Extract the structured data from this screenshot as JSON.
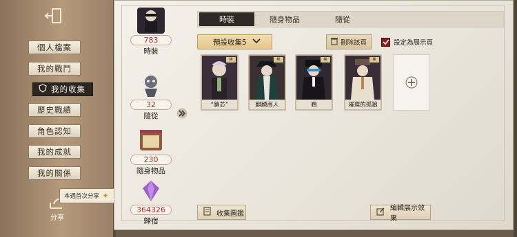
{
  "sidebar": {
    "back_icon": "exit-door-icon",
    "items": [
      {
        "label": "個人檔案"
      },
      {
        "label": "我的戰鬥"
      },
      {
        "label": "我的收集",
        "icon": "shield-icon"
      },
      {
        "label": "歷史戰績"
      },
      {
        "label": "角色認知"
      },
      {
        "label": "我的成就"
      },
      {
        "label": "我的關係"
      }
    ],
    "share_tip": "本週首次分享",
    "share_label": "分享"
  },
  "categories": [
    {
      "label": "時裝",
      "count": "783",
      "thumb_name": "鵜"
    },
    {
      "label": "隨從",
      "count": "32"
    },
    {
      "label": "隨身物品",
      "count": "230"
    },
    {
      "label": "歸宿",
      "count": "364326"
    }
  ],
  "tabs": [
    {
      "label": "時裝",
      "active": true
    },
    {
      "label": "隨身物品",
      "active": false
    },
    {
      "label": "隨從",
      "active": false
    }
  ],
  "toolbar": {
    "preset": "預設收集5",
    "delete_page": "刪除該頁",
    "set_display": "設定為展示頁"
  },
  "cards": [
    {
      "name": "“鎖芯”",
      "tag": "稀"
    },
    {
      "name": "麒麟商人",
      "tag": "稀"
    },
    {
      "name": "鵜",
      "tag": "稀"
    },
    {
      "name": "璀璨的孤狼",
      "tag": "稀"
    }
  ],
  "bottom": {
    "gallery": "收集圖鑑",
    "edit_display": "編輯展示效果"
  },
  "colors": {
    "accent_red": "#a13a35",
    "tab_active": "#2f2a25",
    "preset_gold": "#e4c88e"
  }
}
